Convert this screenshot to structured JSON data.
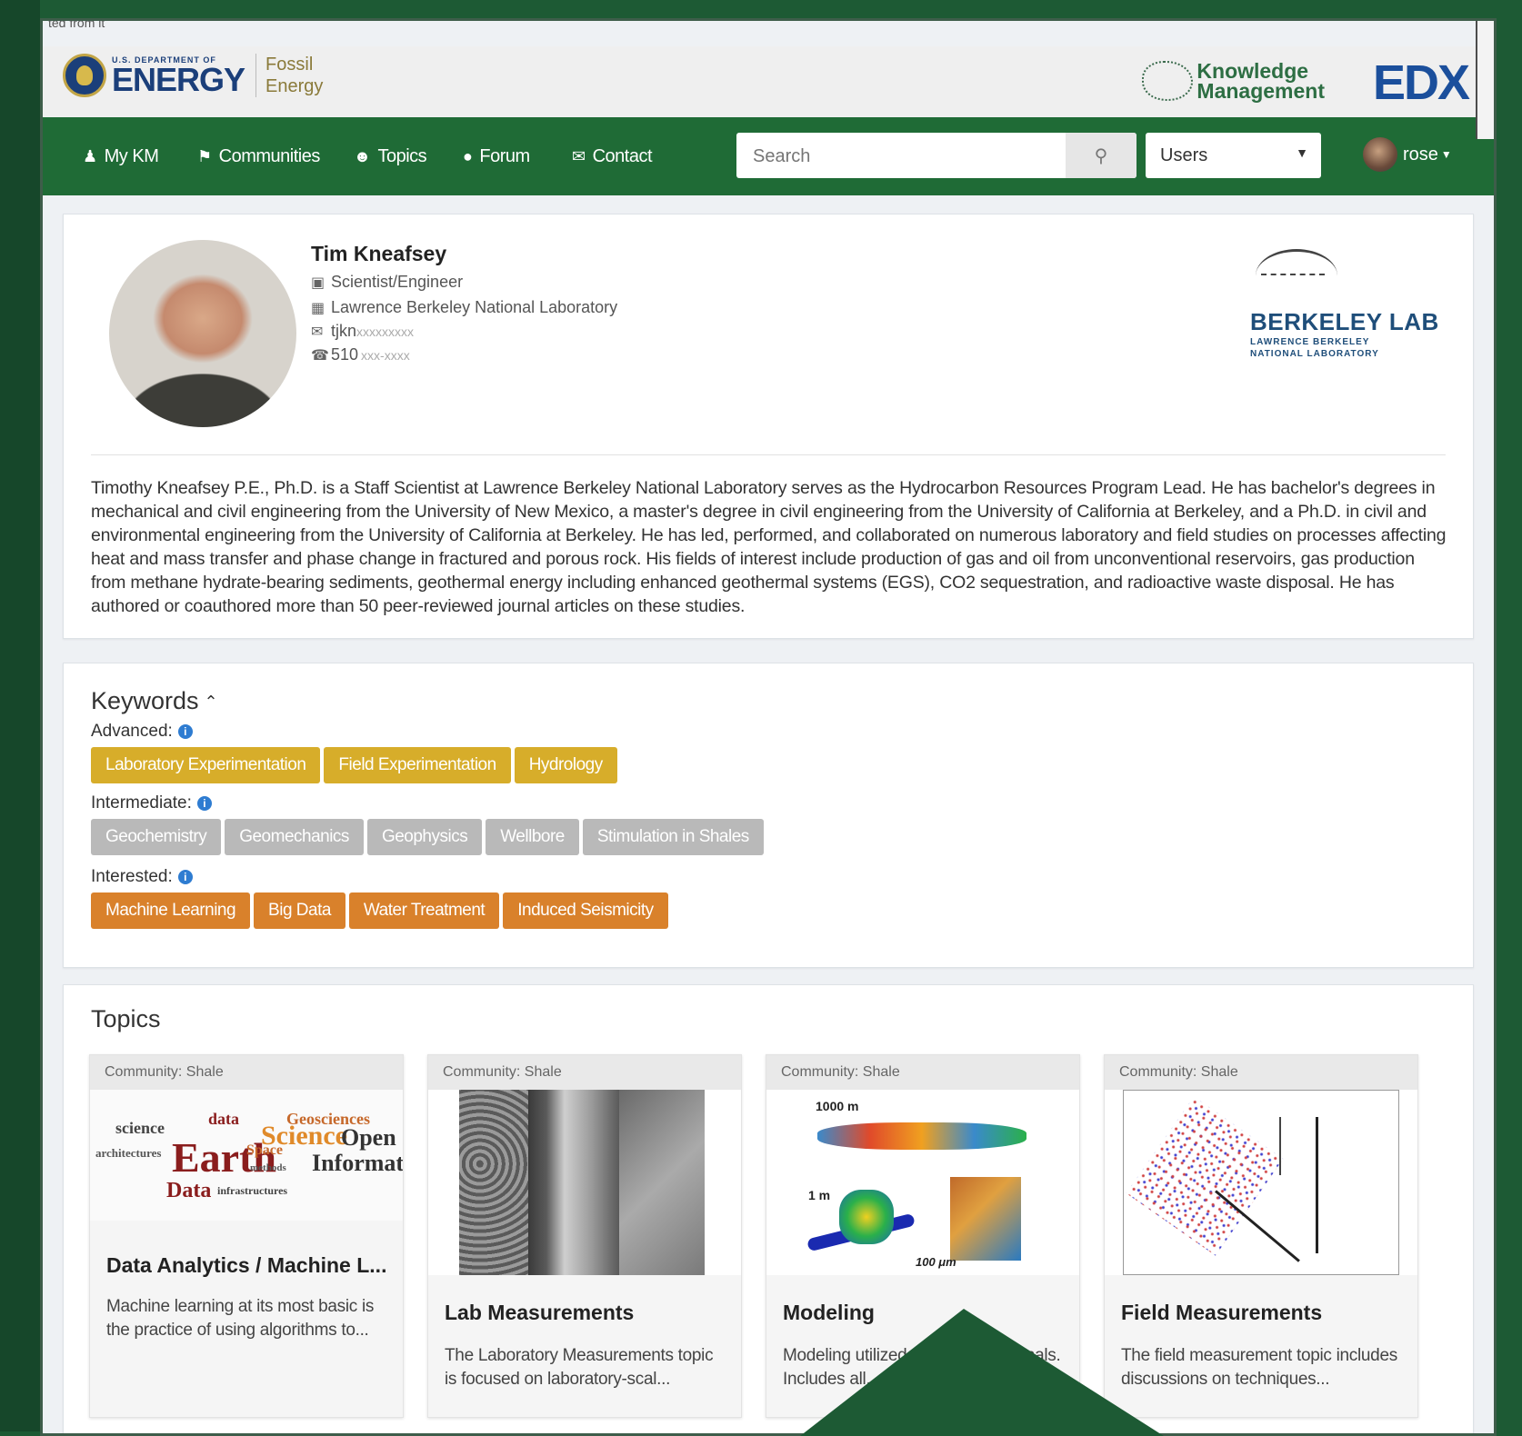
{
  "window": {
    "caption": "ted from it"
  },
  "header": {
    "doe_small": "U.S. DEPARTMENT OF",
    "doe_big": "ENERGY",
    "fe_line1": "Fossil",
    "fe_line2": "Energy",
    "km_line1": "Knowledge",
    "km_line2": "Management",
    "edx": "EDX"
  },
  "nav": {
    "items": [
      {
        "label": "My KM",
        "icon": "user-icon"
      },
      {
        "label": "Communities",
        "icon": "flag-icon"
      },
      {
        "label": "Topics",
        "icon": "users-icon"
      },
      {
        "label": "Forum",
        "icon": "comment-icon"
      },
      {
        "label": "Contact",
        "icon": "envelope-icon"
      }
    ],
    "search_placeholder": "Search",
    "select_value": "Users",
    "user": "rose"
  },
  "profile": {
    "name": "Tim Kneafsey",
    "title": "Scientist/Engineer",
    "organization": "Lawrence Berkeley National Laboratory",
    "email_prefix": "tjkn",
    "email_masked": "xxxxxxxxx",
    "phone_prefix": "510",
    "phone_masked": "xxx-xxxx",
    "lab_name": "BERKELEY LAB",
    "lab_sub1": "LAWRENCE BERKELEY",
    "lab_sub2": "NATIONAL LABORATORY",
    "bio": "Timothy Kneafsey P.E., Ph.D. is a Staff Scientist at Lawrence Berkeley National Laboratory serves as the Hydrocarbon Resources Program Lead. He has bachelor's degrees in mechanical and civil engineering from the University of New Mexico, a master's degree in civil engineering from the University of California at Berkeley, and a Ph.D. in civil and environmental engineering from the University of California at Berkeley. He has led, performed, and collaborated on numerous laboratory and field studies on processes affecting heat and mass transfer and phase change in fractured and porous rock. His fields of interest include production of gas and oil from unconventional reservoirs, gas production from methane hydrate-bearing sediments, geothermal energy including enhanced geothermal systems (EGS), CO2 sequestration, and radioactive waste disposal. He has authored or coauthored more than 50 peer-reviewed journal articles on these studies."
  },
  "keywords": {
    "title": "Keywords",
    "advanced_label": "Advanced:",
    "intermediate_label": "Intermediate:",
    "interested_label": "Interested:",
    "advanced": [
      "Laboratory Experimentation",
      "Field Experimentation",
      "Hydrology"
    ],
    "intermediate": [
      "Geochemistry",
      "Geomechanics",
      "Geophysics",
      "Wellbore",
      "Stimulation in Shales"
    ],
    "interested": [
      "Machine Learning",
      "Big Data",
      "Water Treatment",
      "Induced Seismicity"
    ],
    "colors": {
      "advanced": "#d7ad2a",
      "intermediate": "#b9b9b9",
      "interested": "#d9812b"
    }
  },
  "topics": {
    "title": "Topics",
    "cards": [
      {
        "community": "Community:  Shale",
        "title": "Data Analytics / Machine L...",
        "desc": "Machine learning at its most basic is the practice of using algorithms to..."
      },
      {
        "community": "Community:  Shale",
        "title": "Lab Measurements",
        "desc": "The Laboratory Measurements topic is focused on laboratory-scal..."
      },
      {
        "community": "Community:  Shale",
        "title": "Modeling",
        "desc": "Modeling utilized for unconventionals. Includes all...",
        "img_labels": [
          "1000 m",
          "1 m",
          "100 μm"
        ]
      },
      {
        "community": "Community:  Shale",
        "title": "Field Measurements",
        "desc": "The field measurement topic includes discussions on techniques..."
      }
    ],
    "wordcloud": [
      "science",
      "data",
      "Geosciences",
      "Earth",
      "Space",
      "Science",
      "Open",
      "Informatics",
      "Data",
      "architectures",
      "methods",
      "infrastructures"
    ]
  }
}
